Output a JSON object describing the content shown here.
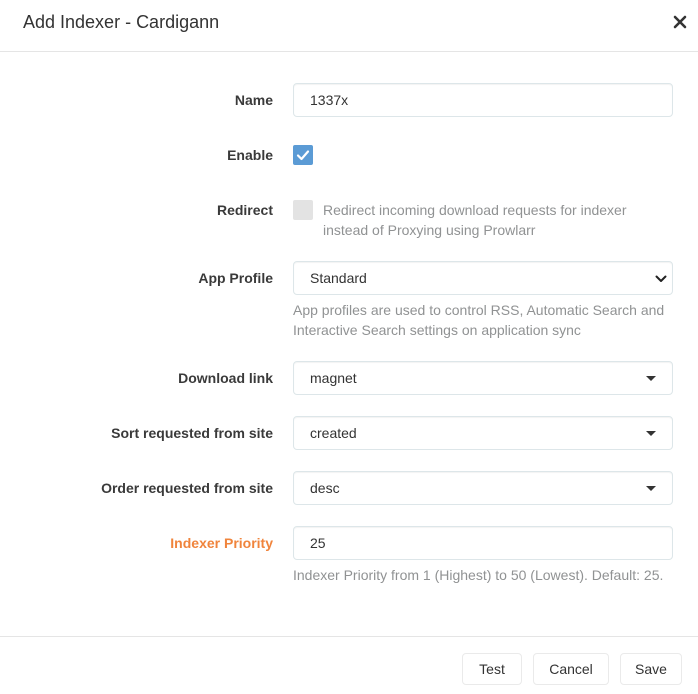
{
  "modal": {
    "title": "Add Indexer - Cardigann"
  },
  "fields": {
    "name": {
      "label": "Name",
      "value": "1337x"
    },
    "enable": {
      "label": "Enable",
      "checked": true
    },
    "redirect": {
      "label": "Redirect",
      "checked": false,
      "help": "Redirect incoming download requests for indexer instead of Proxying using Prowlarr"
    },
    "app_profile": {
      "label": "App Profile",
      "value": "Standard",
      "help": "App profiles are used to control RSS, Automatic Search and Interactive Search settings on application sync"
    },
    "download_link": {
      "label": "Download link",
      "value": "magnet"
    },
    "sort": {
      "label": "Sort requested from site",
      "value": "created"
    },
    "order": {
      "label": "Order requested from site",
      "value": "desc"
    },
    "priority": {
      "label": "Indexer Priority",
      "value": "25",
      "help": "Indexer Priority from 1 (Highest) to 50 (Lowest). Default: 25.",
      "label_color": "#f0843c"
    }
  },
  "footer": {
    "test": "Test",
    "cancel": "Cancel",
    "save": "Save"
  },
  "colors": {
    "accent": "#5b9bd5",
    "warning": "#f0843c"
  }
}
